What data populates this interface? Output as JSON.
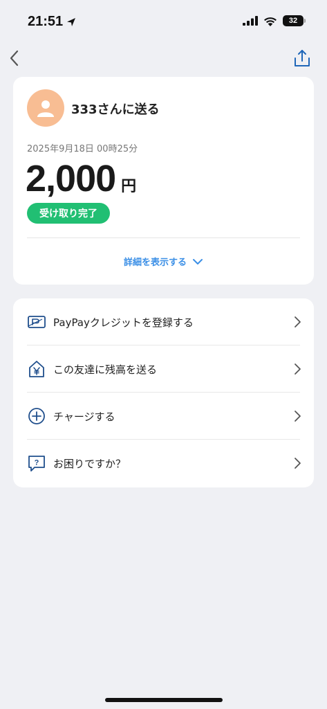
{
  "status_bar": {
    "time": "21:51",
    "battery_level": "32"
  },
  "header": {
    "back_icon": "chevron-left-icon",
    "share_icon": "share-icon"
  },
  "transaction": {
    "recipient": "333さんに送る",
    "datetime": "2025年9月18日 00時25分",
    "amount": "2,000",
    "currency": "円",
    "status": "受け取り完了",
    "details_link": "詳細を表示する"
  },
  "menu": {
    "items": [
      {
        "label": "PayPayクレジットを登録する",
        "icon": "credit-card-icon"
      },
      {
        "label": "この友達に残高を送る",
        "icon": "home-yen-icon"
      },
      {
        "label": "チャージする",
        "icon": "plus-circle-icon"
      },
      {
        "label": "お困りですか？",
        "icon": "help-bubble-icon"
      }
    ]
  },
  "colors": {
    "background": "#eff0f4",
    "status_green": "#21bf73",
    "link_blue": "#3b8fe6",
    "icon_navy": "#1f4e8c",
    "avatar": "#f8bd93"
  }
}
